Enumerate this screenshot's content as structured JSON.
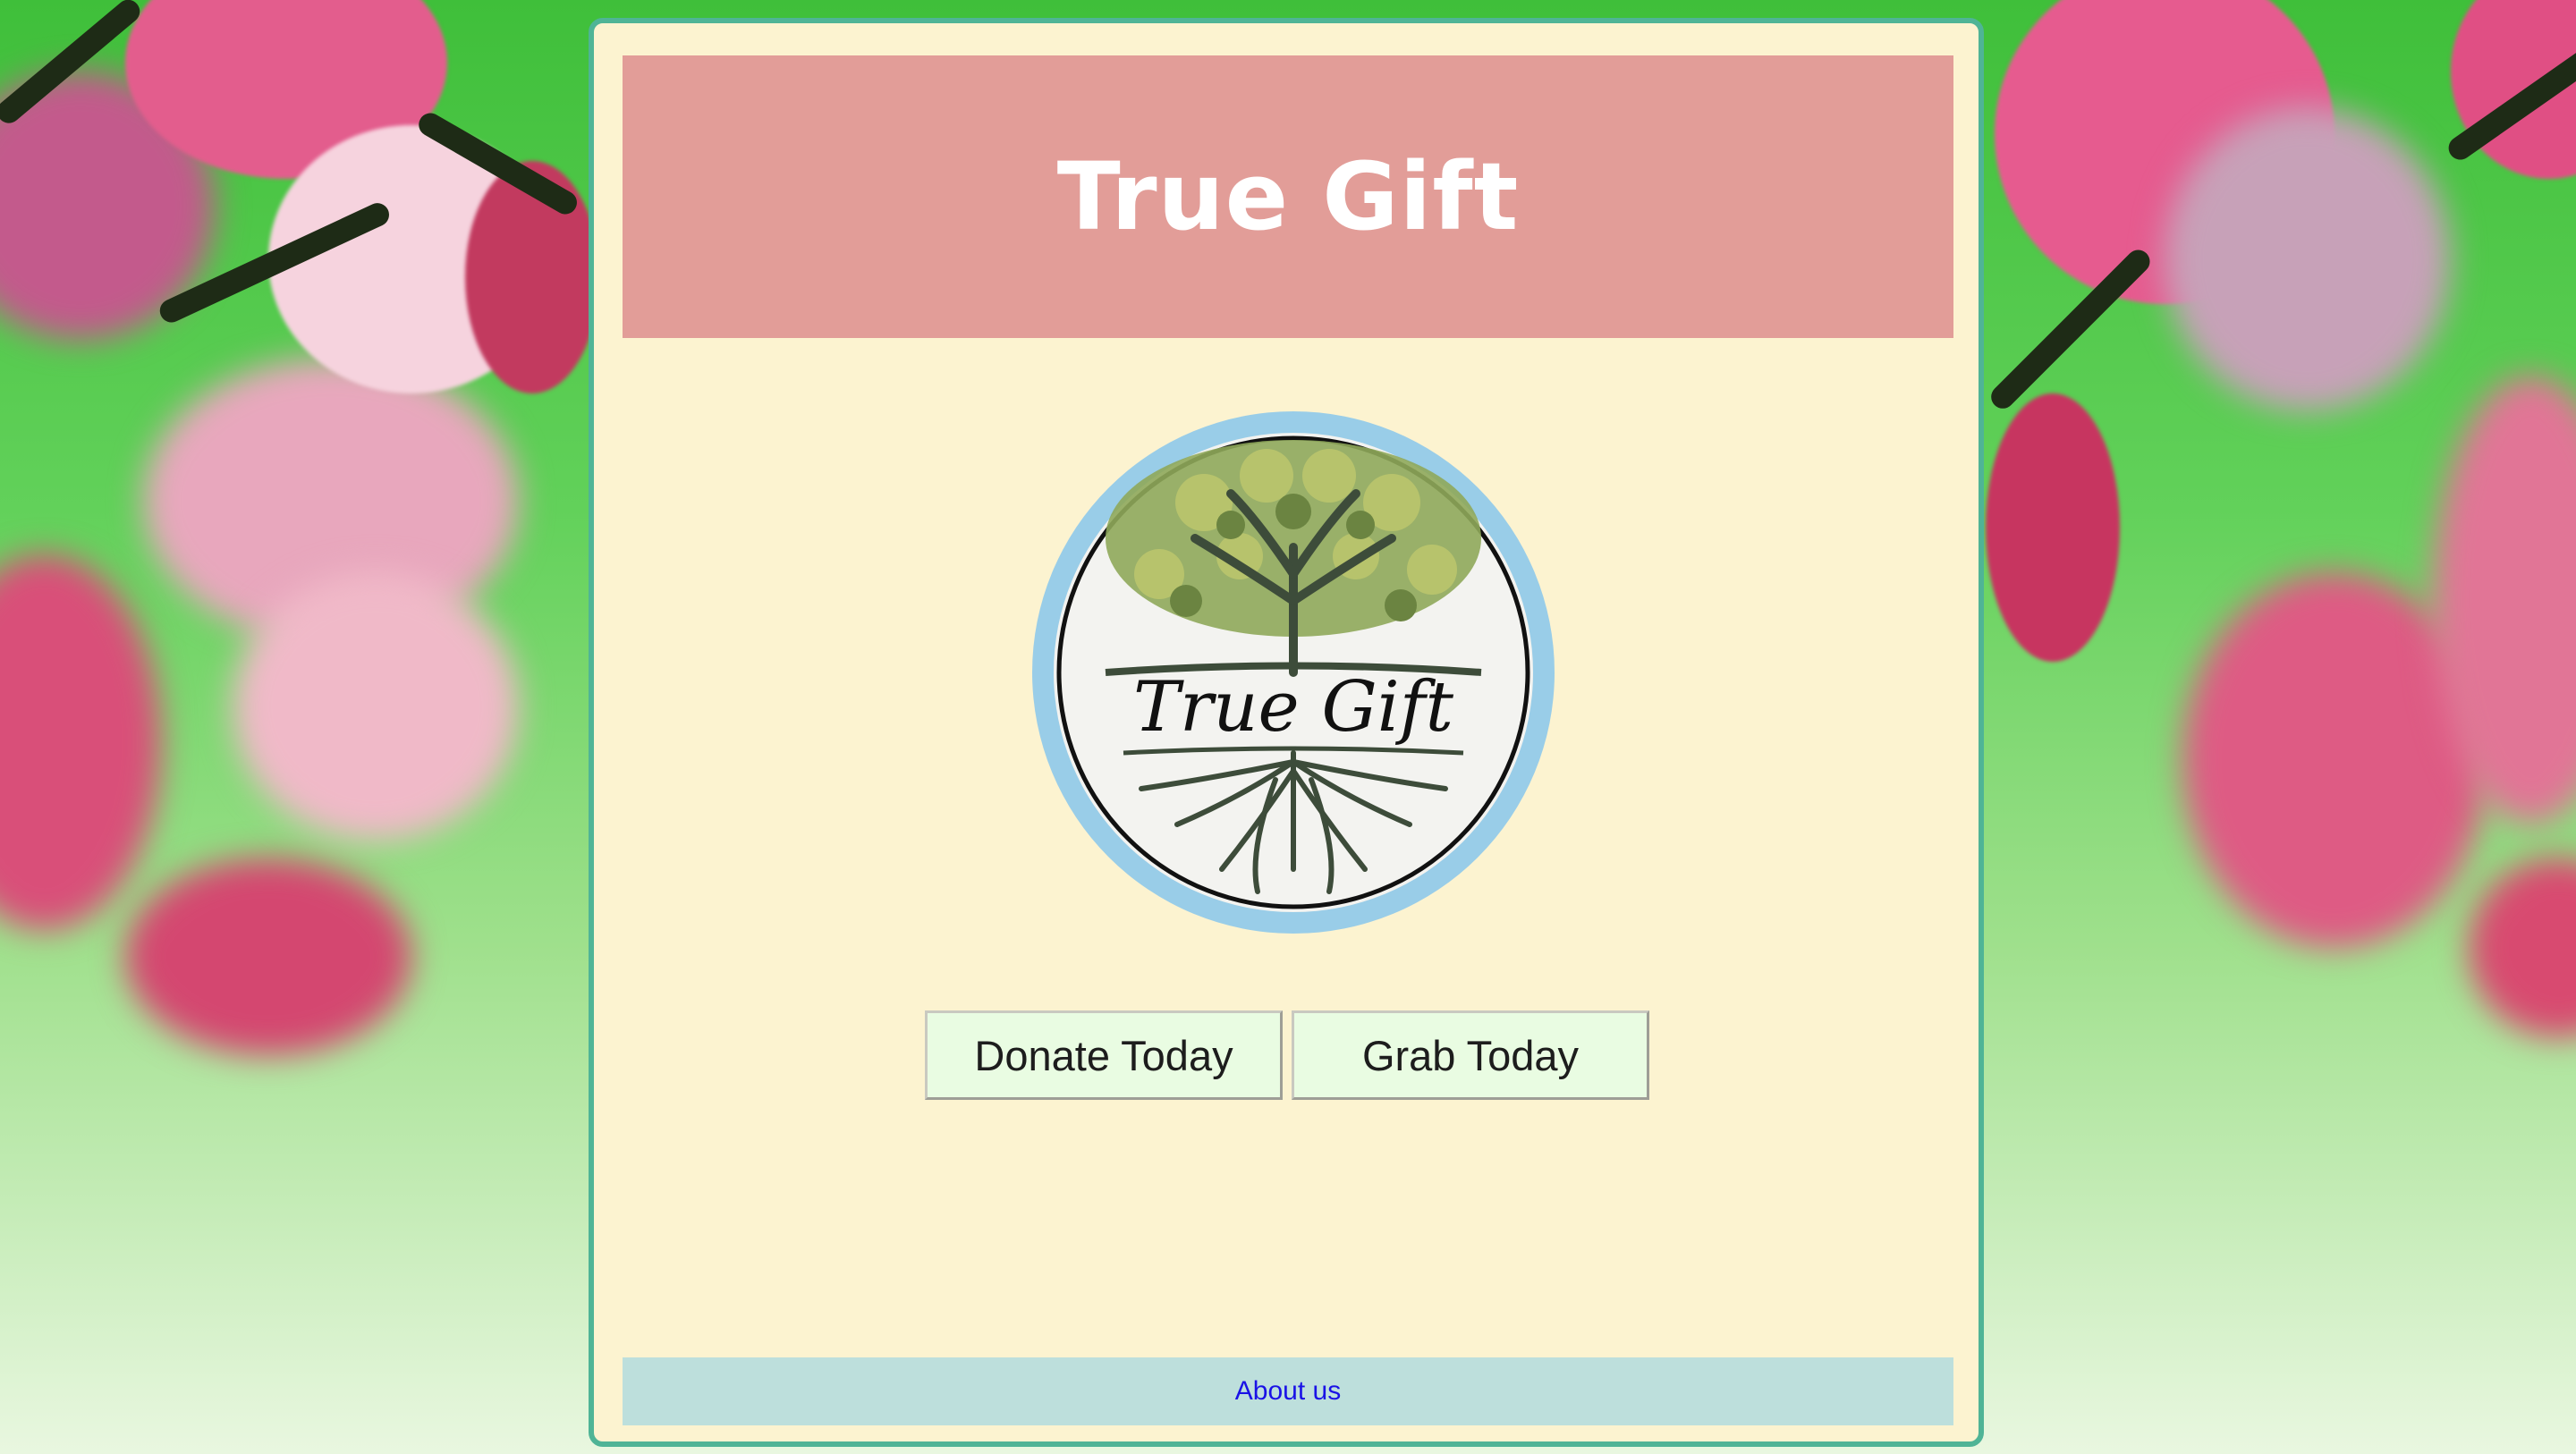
{
  "header": {
    "title": "True Gift"
  },
  "logo": {
    "script_text": "True Gift"
  },
  "actions": {
    "donate_label": "Donate Today",
    "grab_label": "Grab Today"
  },
  "footer": {
    "about_label": "About us"
  },
  "colors": {
    "header_bg": "#e29d98",
    "card_bg": "#fcf3d0",
    "card_border": "#4fb496",
    "footer_bg": "#bddfdc",
    "link": "#1a12e6",
    "button_bg": "#e9fce2",
    "logo_ring": "#99cde8"
  }
}
